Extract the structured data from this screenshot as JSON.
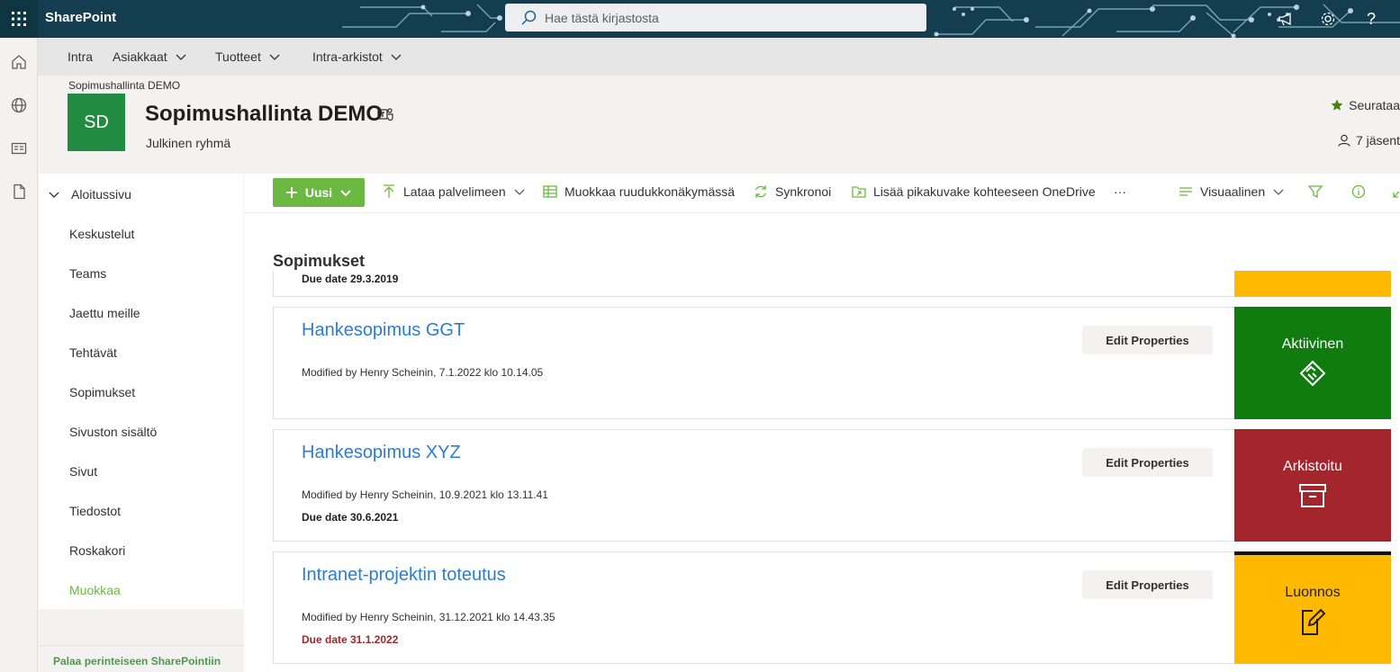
{
  "suitebar": {
    "brand": "SharePoint",
    "search_placeholder": "Hae tästä kirjastosta"
  },
  "hubnav": {
    "items": [
      {
        "label": "Intra",
        "has_dropdown": false
      },
      {
        "label": "Asiakkaat",
        "has_dropdown": true
      },
      {
        "label": "Tuotteet",
        "has_dropdown": true
      },
      {
        "label": "Intra-arkistot",
        "has_dropdown": true
      }
    ]
  },
  "site": {
    "breadcrumb": "Sopimushallinta DEMO",
    "logo_initials": "SD",
    "title": "Sopimushallinta DEMO",
    "subtitle": "Julkinen ryhmä",
    "follow_label": "Seurataa",
    "members_label": "7 jäsent"
  },
  "leftnav": {
    "home": "Aloitussivu",
    "items": [
      "Keskustelut",
      "Teams",
      "Jaettu meille",
      "Tehtävät",
      "Sopimukset",
      "Sivuston sisältö",
      "Sivut",
      "Tiedostot",
      "Roskakori"
    ],
    "edit_label": "Muokkaa",
    "classic_link": "Palaa perinteiseen SharePointiin"
  },
  "commandbar": {
    "new_label": "Uusi",
    "upload_label": "Lataa palvelimeen",
    "grid_edit_label": "Muokkaa ruudukkonäkymässä",
    "sync_label": "Synkronoi",
    "shortcut_label": "Lisää pikakuvake kohteeseen OneDrive",
    "more_label": "···",
    "view_label": "Visuaalinen"
  },
  "list": {
    "title": "Sopimukset",
    "partial_due": "Due date 29.3.2019",
    "items": [
      {
        "title": "Hankesopimus GGT",
        "modified": "Modified by Henry Scheinin, 7.1.2022 klo 10.14.05",
        "due": "",
        "edit_label": "Edit Properties",
        "status": "Aktiivinen",
        "status_color": "#107c10",
        "status_icon": "handshake-icon"
      },
      {
        "title": "Hankesopimus XYZ",
        "modified": "Modified by Henry Scheinin, 10.9.2021 klo 13.11.41",
        "due": "Due date 30.6.2021",
        "edit_label": "Edit Properties",
        "status": "Arkistoitu",
        "status_color": "#a4262c",
        "status_icon": "archive-icon"
      },
      {
        "title": "Intranet-projektin toteutus",
        "modified": "Modified by Henry Scheinin, 31.12.2021 klo 14.43.35",
        "due": "Due date 31.1.2022",
        "edit_label": "Edit Properties",
        "status": "Luonnos",
        "status_color": "#ffb900",
        "status_icon": "edit-document-icon"
      }
    ]
  },
  "colors": {
    "suitebar": "#143e4f",
    "accent_green": "#6bb842",
    "link_blue": "#2b7cd3",
    "partial_status": "#ffb900"
  }
}
